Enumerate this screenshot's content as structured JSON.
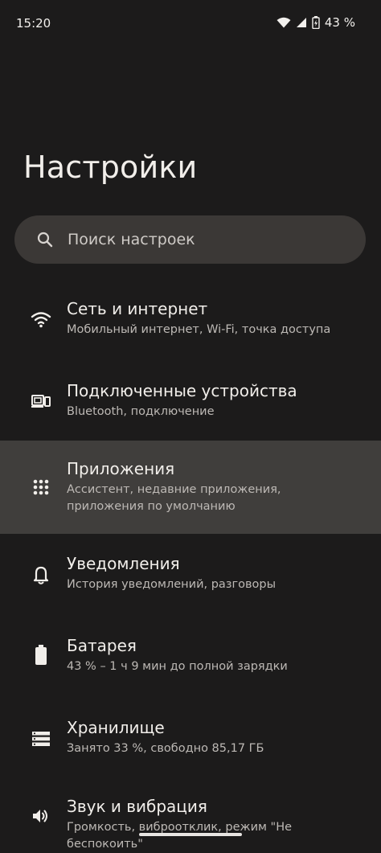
{
  "status_bar": {
    "time": "15:20",
    "battery_percent": "43 %",
    "icons": [
      "wifi-icon",
      "signal-icon",
      "battery-charging-icon"
    ]
  },
  "page": {
    "title": "Настройки"
  },
  "search": {
    "placeholder": "Поиск настроек",
    "icon": "search-icon"
  },
  "settings": {
    "items": [
      {
        "title": "Сеть и интернет",
        "subtitle": "Мобильный интернет, Wi‑Fi, точка доступа",
        "icon": "wifi-icon"
      },
      {
        "title": "Подключенные устройства",
        "subtitle": "Bluetooth, подключение",
        "icon": "connected-devices-icon"
      },
      {
        "title": "Приложения",
        "subtitle": "Ассистент, недавние приложения, приложения по умолчанию",
        "icon": "apps-grid-icon"
      },
      {
        "title": "Уведомления",
        "subtitle": "История уведомлений, разговоры",
        "icon": "bell-icon"
      },
      {
        "title": "Батарея",
        "subtitle": "43 % – 1 ч 9 мин до полной зарядки",
        "icon": "battery-icon"
      },
      {
        "title": "Хранилище",
        "subtitle": "Занято 33 %, свободно 85,17 ГБ",
        "icon": "storage-icon"
      },
      {
        "title": "Звук и вибрация",
        "subtitle": "Громкость, виброотклик, режим \"Не беспокоить\"",
        "icon": "volume-icon"
      }
    ]
  },
  "colors": {
    "background": "#1c1b1b",
    "search_background": "#3b3836",
    "highlight": "#403e3c",
    "text_primary": "#f1eeea",
    "text_secondary": "#bdb9b5"
  }
}
